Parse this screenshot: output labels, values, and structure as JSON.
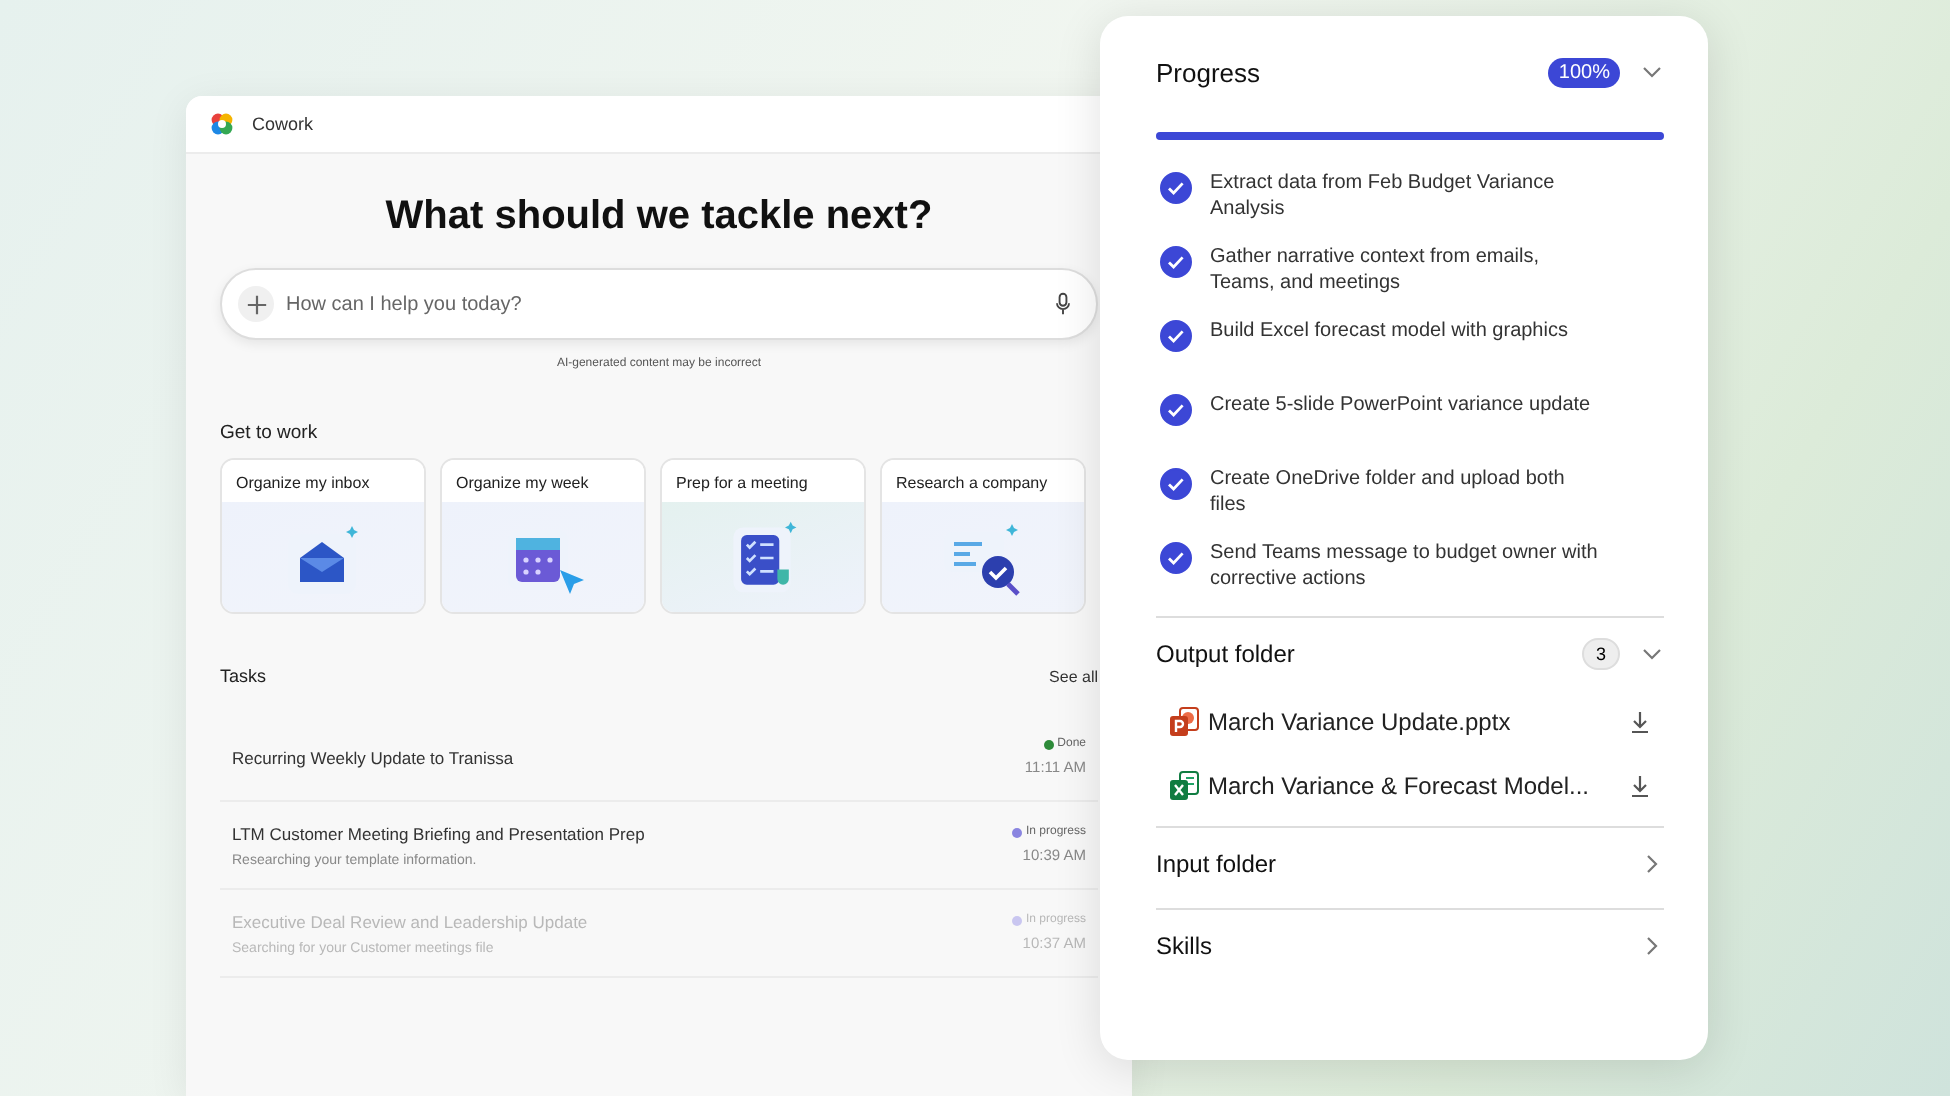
{
  "app": {
    "title": "Cowork"
  },
  "heading": "What should we tackle next?",
  "prompt": {
    "placeholder": "How can I help you today?",
    "disclaimer": "AI-generated content may be incorrect"
  },
  "get_to_work": {
    "title": "Get to work",
    "cards": [
      {
        "label": "Organize my inbox",
        "kind": "inbox"
      },
      {
        "label": "Organize my week",
        "kind": "calendar"
      },
      {
        "label": "Prep for a meeting",
        "kind": "checklist"
      },
      {
        "label": "Research a company",
        "kind": "research"
      }
    ]
  },
  "tasks": {
    "title": "Tasks",
    "see_all": "See all",
    "rows": [
      {
        "title": "Recurring Weekly Update to Tranissa",
        "status": "Done",
        "color": "#2e8b3a",
        "time": "11:11 AM",
        "faded": false
      },
      {
        "title": "LTM Customer Meeting Briefing and Presentation Prep",
        "subtitle": "Researching your template information.",
        "status": "In progress",
        "color": "#8a85e0",
        "time": "10:39 AM",
        "faded": false
      },
      {
        "title": "Executive Deal Review and Leadership Update",
        "subtitle": "Searching for your Customer meetings file",
        "status": "In progress",
        "color": "#c9c6f0",
        "time": "10:37 AM",
        "faded": true
      }
    ]
  },
  "panel": {
    "progress": {
      "title": "Progress",
      "badge": "100%",
      "level": 1,
      "expanded": true,
      "steps": [
        {
          "text": "Extract data from Feb Budget Variance Analysis",
          "done": true
        },
        {
          "text": "Gather narrative context from emails, Teams, and meetings",
          "done": true
        },
        {
          "text": "Build Excel forecast model with graphics",
          "done": true
        },
        {
          "text": "Create 5-slide PowerPoint variance update",
          "done": true
        },
        {
          "text": "Create OneDrive folder and upload both files",
          "done": true
        },
        {
          "text": "Send Teams message to budget owner with corrective actions",
          "done": true
        }
      ]
    },
    "output_folder": {
      "title": "Output folder",
      "count": "3",
      "expanded": true,
      "files": [
        {
          "name": "March Variance Update.pptx",
          "kind": "pptx"
        },
        {
          "name": "March Variance & Forecast Model...",
          "kind": "xlsx"
        }
      ]
    },
    "sections": [
      {
        "title": "Input folder",
        "expanded": false
      },
      {
        "title": "Skills",
        "expanded": false
      }
    ]
  }
}
